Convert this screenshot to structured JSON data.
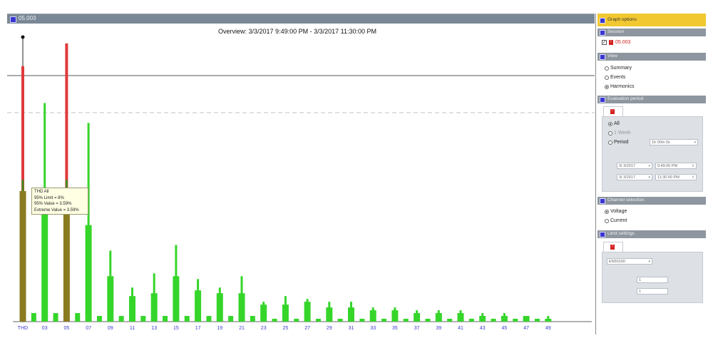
{
  "window": {
    "title": "05.003"
  },
  "chart_data": {
    "type": "bar",
    "title": "Overview: 3/3/2017 9:49:00 PM - 3/3/2017 11:30:00 PM",
    "ylim": [
      0,
      1
    ],
    "x_tick_labels": [
      "THD",
      "03",
      "05",
      "07",
      "09",
      "11",
      "13",
      "15",
      "17",
      "19",
      "21",
      "23",
      "25",
      "27",
      "29",
      "31",
      "33",
      "35",
      "37",
      "39",
      "41",
      "43",
      "45",
      "47",
      "49"
    ],
    "series": [
      {
        "name": "95% Value",
        "color": "#35d52a",
        "values": [
          0.46,
          0.03,
          0.39,
          0.03,
          0.46,
          0.03,
          0.34,
          0.02,
          0.16,
          0.02,
          0.09,
          0.02,
          0.1,
          0.02,
          0.16,
          0.02,
          0.11,
          0.02,
          0.1,
          0.02,
          0.1,
          0.02,
          0.06,
          0.01,
          0.06,
          0.01,
          0.07,
          0.01,
          0.05,
          0.01,
          0.05,
          0.01,
          0.04,
          0.01,
          0.04,
          0.01,
          0.03,
          0.01,
          0.03,
          0.01,
          0.03,
          0.01,
          0.02,
          0.01,
          0.02,
          0.01,
          0.02,
          0.01,
          0.01
        ]
      },
      {
        "name": "Extreme Value",
        "color": "#35d52a",
        "values": [
          0.5,
          0.03,
          0.77,
          0.03,
          0.5,
          0.03,
          0.7,
          0.02,
          0.25,
          0.02,
          0.12,
          0.02,
          0.17,
          0.02,
          0.27,
          0.02,
          0.15,
          0.02,
          0.12,
          0.02,
          0.16,
          0.02,
          0.07,
          0.01,
          0.09,
          0.01,
          0.08,
          0.01,
          0.07,
          0.01,
          0.07,
          0.01,
          0.05,
          0.01,
          0.05,
          0.01,
          0.04,
          0.01,
          0.04,
          0.01,
          0.04,
          0.01,
          0.03,
          0.01,
          0.03,
          0.01,
          0.02,
          0.01,
          0.02
        ]
      },
      {
        "name": "95% Limit",
        "color": "#e03a3a",
        "values_at": {
          "THD": 0.9,
          "05": 0.98
        }
      }
    ],
    "tooltip": {
      "lines": [
        "THD All",
        "95% Limit = 8%",
        "95% Value = 3.59%",
        "Extreme Value = 3.59%"
      ]
    },
    "reference_lines": [
      {
        "style": "solid"
      },
      {
        "style": "dashed"
      }
    ],
    "grid": false
  },
  "panel": {
    "title": "Graph options",
    "sections": {
      "session": {
        "title": "Session",
        "item_label": "05.003"
      },
      "view": {
        "title": "View",
        "options": [
          "Summary",
          "Events",
          "Harmonics"
        ],
        "selected": "Harmonics"
      },
      "evaluation": {
        "title": "Evaluation period",
        "options": [
          "All",
          "1 Week",
          "Period"
        ],
        "selected": "All",
        "period_value": "1h 00m 0s",
        "from_date": "3/ 3/2017",
        "from_time": "9:49:00 PM",
        "to_date": "3/ 3/2017",
        "to_time": "11:30:00 PM"
      },
      "channel": {
        "title": "Channel selection",
        "options": [
          "Voltage",
          "Current"
        ],
        "selected": "Voltage"
      },
      "limits": {
        "title": "Limit settings",
        "preset": "EN50160",
        "value1": "1",
        "value2": "1"
      }
    }
  }
}
